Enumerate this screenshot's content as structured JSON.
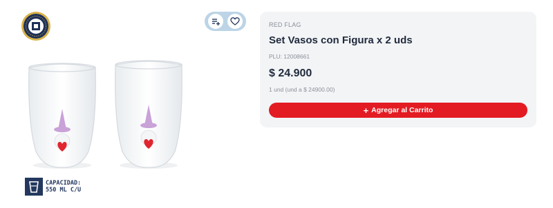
{
  "product": {
    "brand": "RED FLAG",
    "title": "Set Vasos con Figura x 2 uds",
    "plu": "PLU: 12008661",
    "price": "$ 24.900",
    "unit_price": "1 und (und a $ 24900.00)"
  },
  "cart": {
    "add_label": "Agregar al Carrito",
    "plus_glyph": "+"
  },
  "capacity": {
    "line1": "CAPACIDAD:",
    "line2": "550 ML C/U"
  },
  "icons": {
    "seal": "quality-seal-icon",
    "add_to_list": "add-to-list-icon",
    "favorite": "heart-icon",
    "capacity": "glass-capacity-icon",
    "cart_plus": "plus-icon"
  },
  "colors": {
    "accent": "#e31b23",
    "navy": "#24385e",
    "card_bg": "#f3f4f6",
    "pill_bg": "#bcd4e6"
  }
}
